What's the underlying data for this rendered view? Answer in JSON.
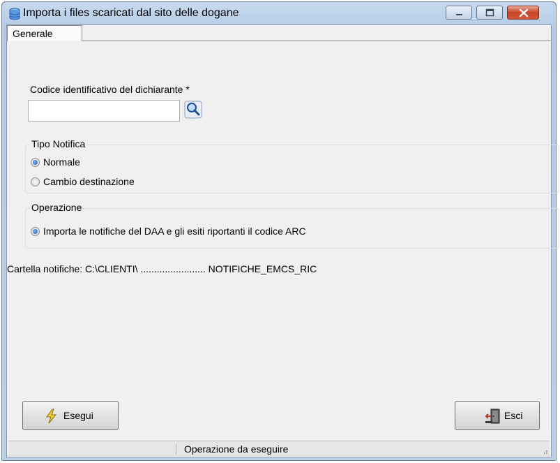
{
  "window": {
    "title": "Importa i files scaricati dal sito delle dogane"
  },
  "tabs": [
    {
      "label": "Generale",
      "active": true
    }
  ],
  "dichiarante": {
    "label": "Codice identificativo del dichiarante *",
    "value": "",
    "search_icon": "magnifier-icon"
  },
  "tipo_notifica": {
    "legend": "Tipo Notifica",
    "options": [
      {
        "label": "Normale",
        "checked": true
      },
      {
        "label": "Cambio destinazione",
        "checked": false
      }
    ]
  },
  "operazione": {
    "legend": "Operazione",
    "options": [
      {
        "label": "Importa le notifiche del DAA e gli esiti riportanti il codice ARC",
        "checked": true
      }
    ]
  },
  "cartella": {
    "text": "Cartella notifiche: C:\\CLIENTI\\ ........................ NOTIFICHE_EMCS_RIC"
  },
  "buttons": {
    "esegui": {
      "label": "Esegui",
      "icon": "lightning-icon"
    },
    "esci": {
      "label": "Esci",
      "icon": "exit-door-icon"
    }
  },
  "status": {
    "text": "Operazione da eseguire"
  },
  "colors": {
    "accent_close": "#c8452a",
    "radio_selected": "#1b58b8"
  }
}
